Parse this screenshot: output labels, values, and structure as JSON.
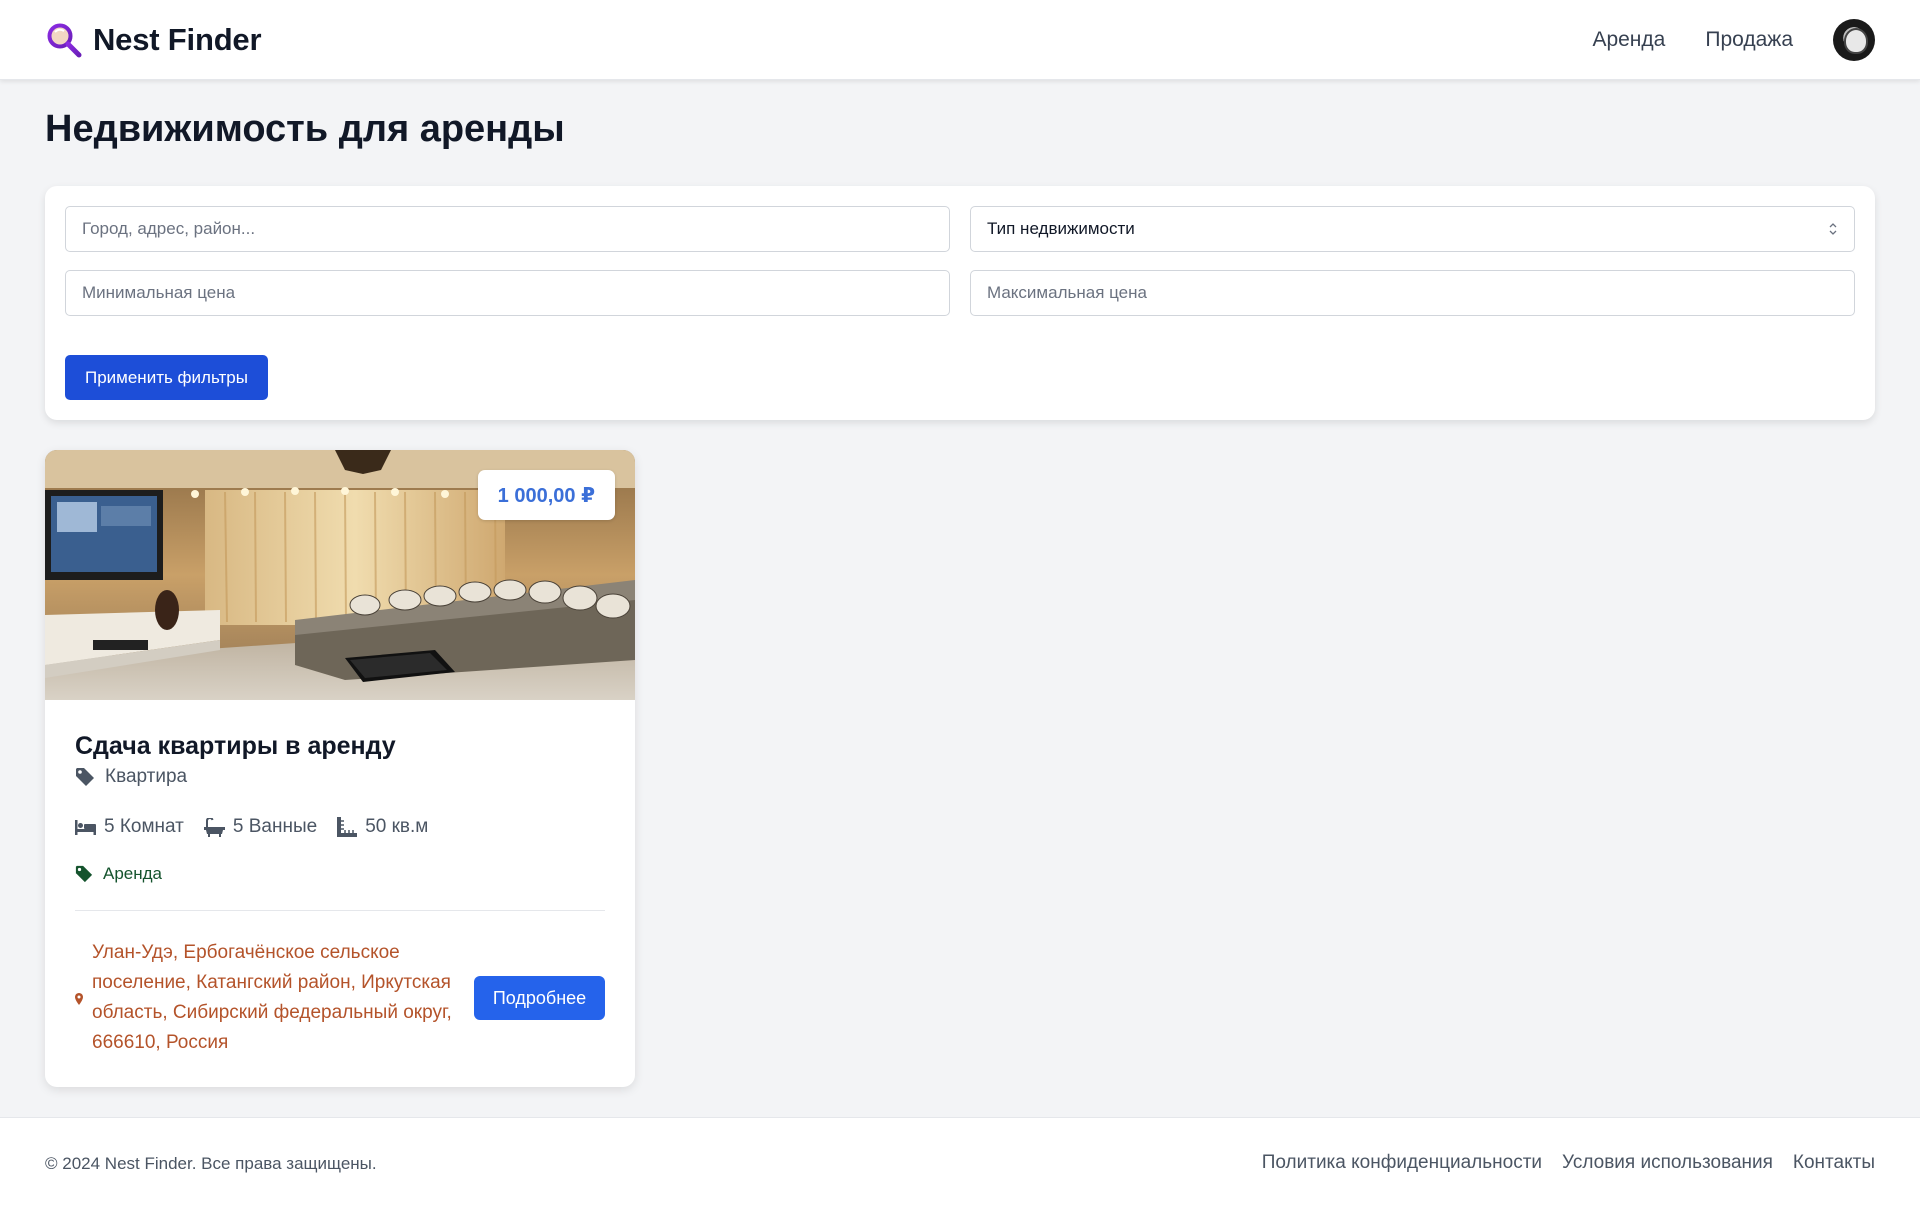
{
  "header": {
    "brand": "Nest Finder",
    "nav": [
      "Аренда",
      "Продажа"
    ]
  },
  "page": {
    "title": "Недвижимость для аренды"
  },
  "filters": {
    "search_placeholder": "Город, адрес, район...",
    "type_selected": "Тип недвижимости",
    "min_price_placeholder": "Минимальная цена",
    "max_price_placeholder": "Максимальная цена",
    "apply_label": "Применить фильтры"
  },
  "listing": {
    "price": "1 000,00 ₽",
    "title": "Сдача квартиры в аренду",
    "property_type": "Квартира",
    "rooms": "5 Комнат",
    "bathrooms": "5 Ванные",
    "area": "50 кв.м",
    "deal_type": "Аренда",
    "address": "Улан-Удэ, Ербогачёнское сельское поселение, Катангский район, Иркутская область, Сибирский федеральный округ, 666610, Россия",
    "details_label": "Подробнее"
  },
  "footer": {
    "copyright": "© 2024 Nest Finder. Все права защищены.",
    "links": [
      "Политика конфиденциальности",
      "Условия использования",
      "Контакты"
    ]
  },
  "colors": {
    "primary": "#1d4ed8",
    "price": "#3b6fd8",
    "address": "#b4532a",
    "deal": "#14532d",
    "background": "#f3f4f6"
  },
  "icons": {
    "logo": "magnifier-logo-icon",
    "type": "tag-icon",
    "rooms": "bed-icon",
    "bath": "bathtub-icon",
    "area": "ruler-icon",
    "deal": "tag-icon",
    "address": "map-pin-icon"
  }
}
